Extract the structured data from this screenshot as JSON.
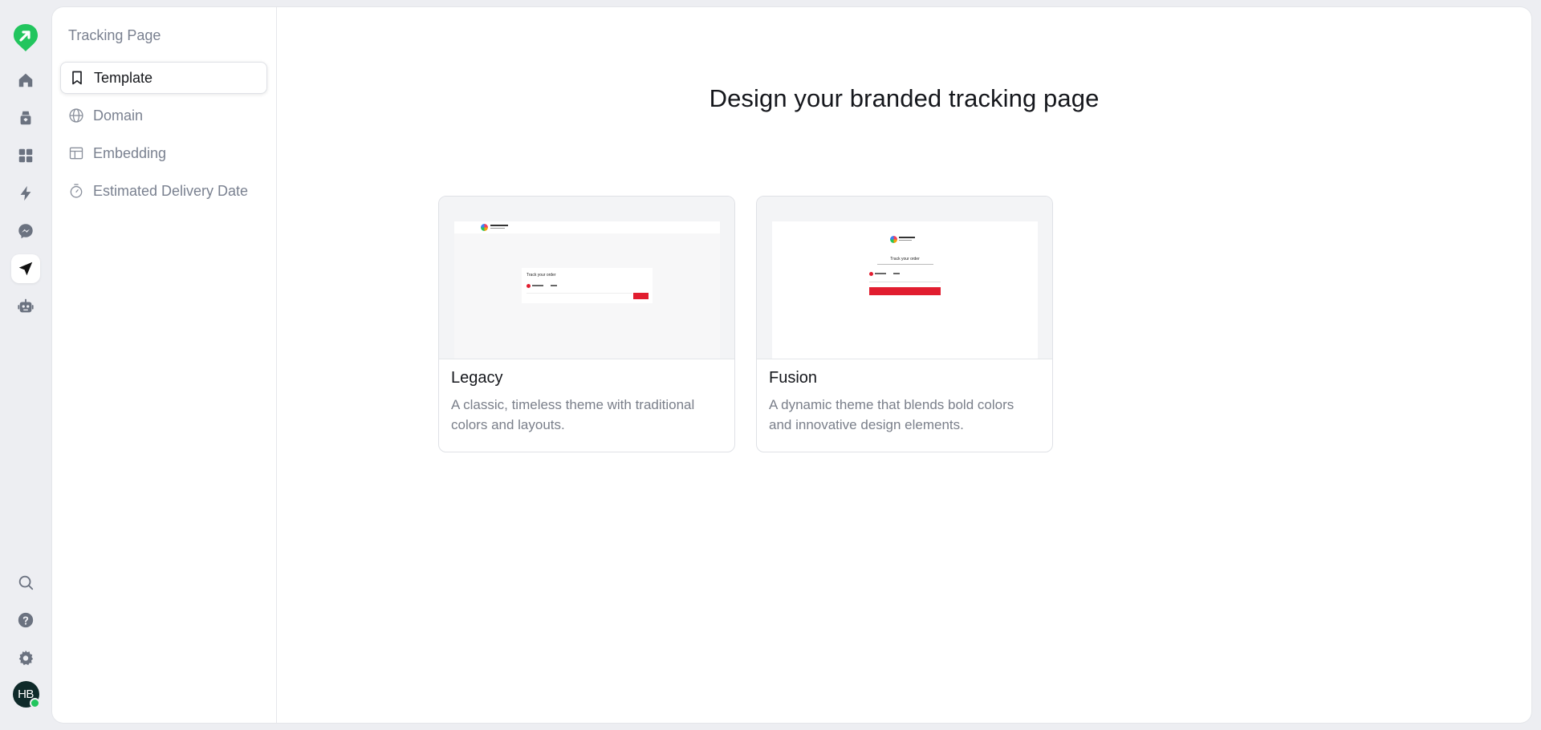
{
  "app": {
    "brand_color": "#22c55e",
    "icon_color": "#6b7280"
  },
  "rail": {
    "items": [
      {
        "icon": "home-icon"
      },
      {
        "icon": "box-icon"
      },
      {
        "icon": "grid-icon"
      },
      {
        "icon": "bolt-icon"
      },
      {
        "icon": "messenger-icon"
      },
      {
        "icon": "send-icon",
        "active": true
      },
      {
        "icon": "robot-icon"
      }
    ],
    "bottom": [
      {
        "icon": "search-icon"
      },
      {
        "icon": "help-icon"
      },
      {
        "icon": "gear-icon"
      }
    ],
    "avatar": {
      "initials": "HB",
      "status": "online"
    }
  },
  "subnav": {
    "title": "Tracking Page",
    "items": [
      {
        "label": "Template",
        "icon": "bookmark-icon",
        "active": true
      },
      {
        "label": "Domain",
        "icon": "globe-icon"
      },
      {
        "label": "Embedding",
        "icon": "layout-icon"
      },
      {
        "label": "Estimated Delivery Date",
        "icon": "timer-icon"
      }
    ]
  },
  "main": {
    "heading": "Design your branded tracking page",
    "cards": [
      {
        "name": "Legacy",
        "description": "A classic, timeless theme with traditional colors and layouts.",
        "preview_title": "Track your order"
      },
      {
        "name": "Fusion",
        "description": "A dynamic theme that blends bold colors and innovative design elements.",
        "preview_title": "Track your order"
      }
    ]
  }
}
